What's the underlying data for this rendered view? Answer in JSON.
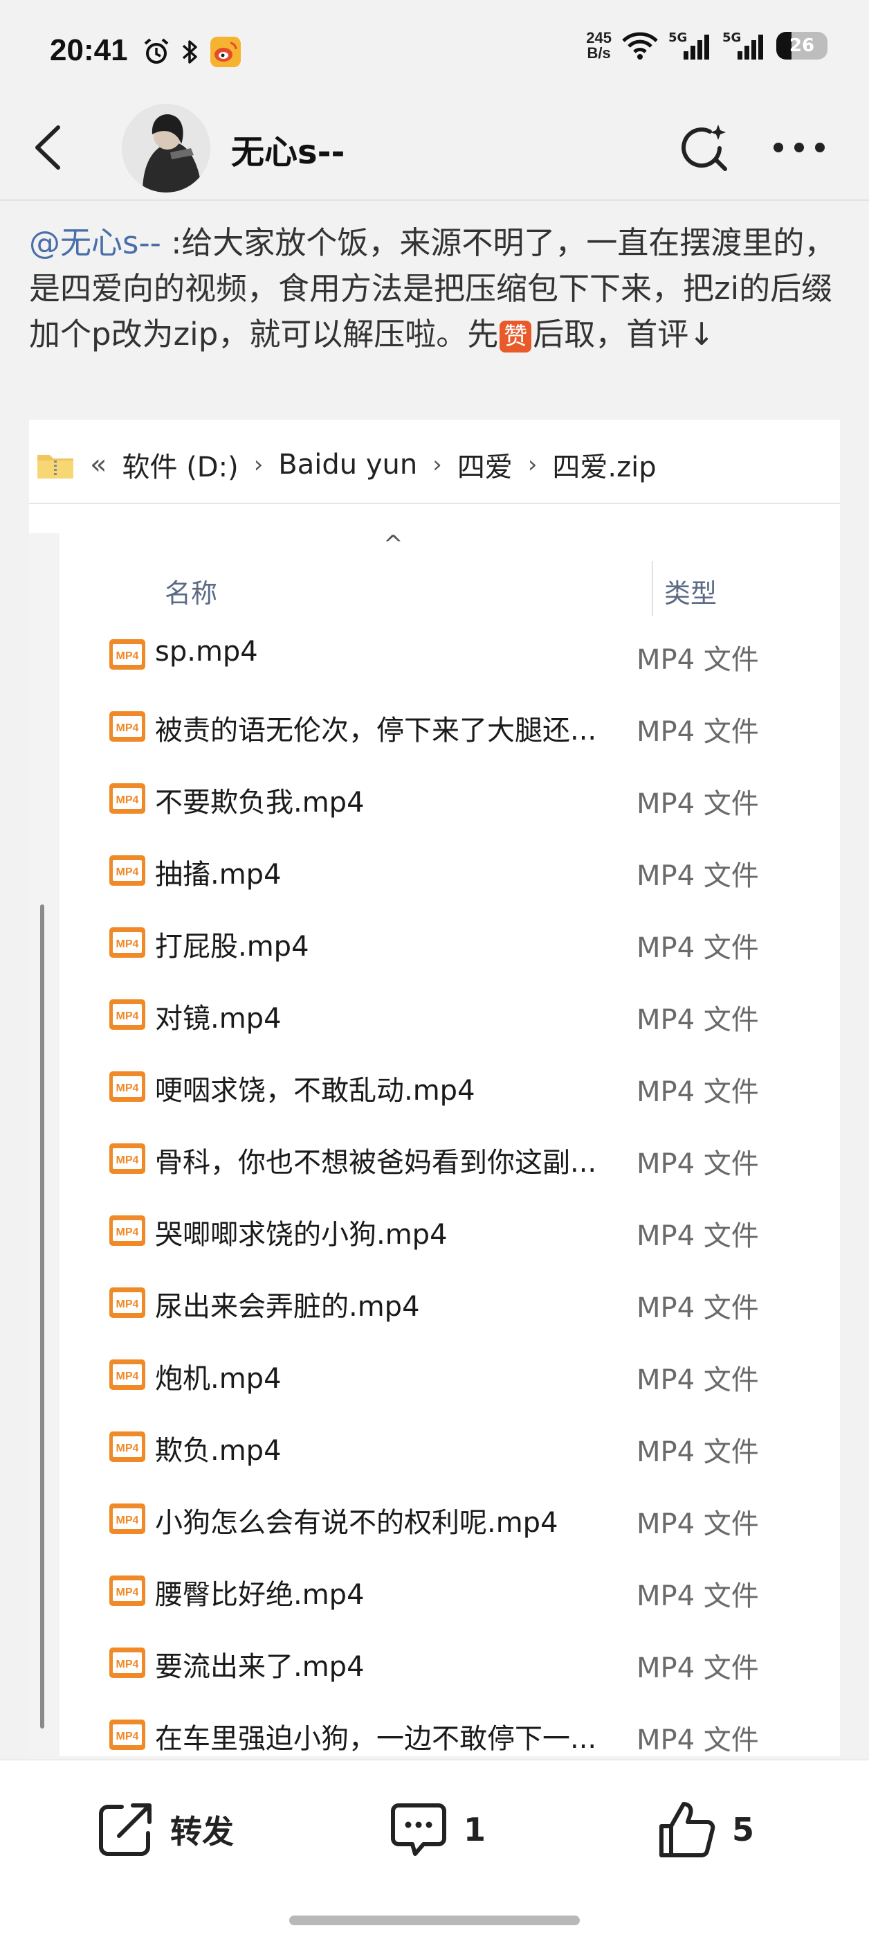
{
  "status_bar": {
    "time": "20:41",
    "net_speed_value": "245",
    "net_speed_unit": "B/s",
    "sig1": "5G",
    "sig2": "5G",
    "battery": "26"
  },
  "header": {
    "username": "无心s--"
  },
  "post": {
    "mention": "@无心s--",
    "text_before": " :给大家放个饭，来源不明了，一直在摆渡里的，是四爱向的视频，食用方法是把压缩包下下来，把zi的后缀加个p改为zip，就可以解压啦。先",
    "zan_emoji": "赞",
    "text_after": "后取，首评↓"
  },
  "explorer": {
    "path_prefix": "«",
    "path": [
      "软件 (D:)",
      "Baidu yun",
      "四爱",
      "四爱.zip"
    ],
    "col_name": "名称",
    "col_type": "类型",
    "files": [
      {
        "name": "sp.mp4",
        "type": "MP4 文件"
      },
      {
        "name": "被责的语无伦次，停下来了大腿还...",
        "type": "MP4 文件"
      },
      {
        "name": "不要欺负我.mp4",
        "type": "MP4 文件"
      },
      {
        "name": "抽搐.mp4",
        "type": "MP4 文件"
      },
      {
        "name": "打屁股.mp4",
        "type": "MP4 文件"
      },
      {
        "name": "对镜.mp4",
        "type": "MP4 文件"
      },
      {
        "name": "哽咽求饶，不敢乱动.mp4",
        "type": "MP4 文件"
      },
      {
        "name": "骨科，你也不想被爸妈看到你这副...",
        "type": "MP4 文件"
      },
      {
        "name": "哭唧唧求饶的小狗.mp4",
        "type": "MP4 文件"
      },
      {
        "name": "尿出来会弄脏的.mp4",
        "type": "MP4 文件"
      },
      {
        "name": "炮机.mp4",
        "type": "MP4 文件"
      },
      {
        "name": "欺负.mp4",
        "type": "MP4 文件"
      },
      {
        "name": "小狗怎么会有说不的权利呢.mp4",
        "type": "MP4 文件"
      },
      {
        "name": "腰臀比好绝.mp4",
        "type": "MP4 文件"
      },
      {
        "name": "要流出来了.mp4",
        "type": "MP4 文件"
      },
      {
        "name": "在车里强迫小狗，一边不敢停下一...",
        "type": "MP4 文件"
      }
    ]
  },
  "actions": {
    "repost_label": "转发",
    "comment_count": "1",
    "like_count": "5"
  }
}
